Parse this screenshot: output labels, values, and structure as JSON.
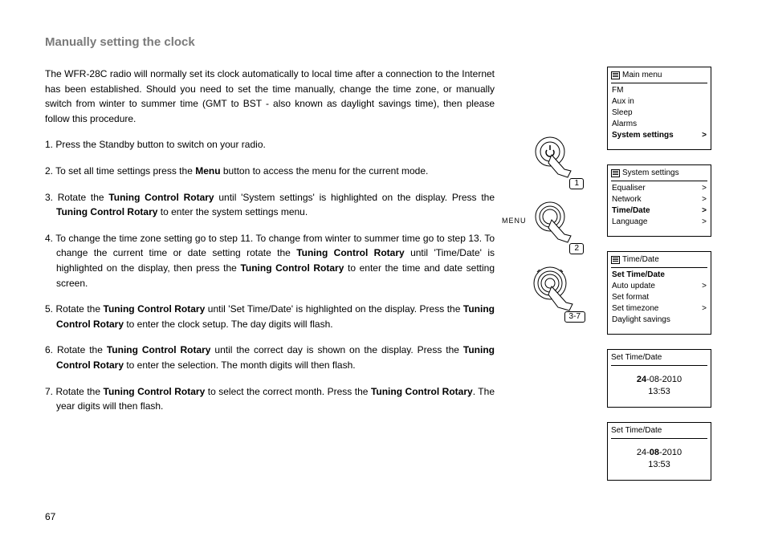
{
  "title": "Manually setting the clock",
  "page_num": "67",
  "intro": "The WFR-28C radio will normally set its clock automatically to local time after a connection to the Internet has been established. Should you need to set the time manually, change the time zone, or manually switch from winter to summer time (GMT to BST - also known as daylight savings time), then please follow this procedure.",
  "steps": {
    "s1": "1. Press the Standby button to switch on your radio.",
    "s2a": "2. To set all time settings press the ",
    "s2b": "Menu",
    "s2c": " button to access the menu for the current mode.",
    "s3a": "3. Rotate the ",
    "s3b": "Tuning Control Rotary",
    "s3c": " until 'System settings' is highlighted on the display. Press the ",
    "s3d": "Tuning Control Rotary",
    "s3e": " to enter the system settings menu.",
    "s4a": "4. To change the time zone setting go to step 11. To change from winter to summer time go to step 13. To change the current time or date setting rotate the ",
    "s4b": "Tuning Control Rotary",
    "s4c": " until 'Time/Date'  is highlighted on the display, then press the ",
    "s4d": "Tuning Control Rotary",
    "s4e": " to enter the time and date setting screen.",
    "s5a": "5. Rotate the ",
    "s5b": "Tuning Control Rotary",
    "s5c": " until 'Set Time/Date' is highlighted on the display. Press the ",
    "s5d": "Tuning Control Rotary",
    "s5e": " to enter the clock setup. The day digits will flash.",
    "s6a": "6. Rotate the ",
    "s6b": "Tuning Control Rotary",
    "s6c": " until the correct day is shown on the display. Press the ",
    "s6d": "Tuning Control Rotary",
    "s6e": " to enter the selection. The month digits will then flash.",
    "s7a": "7. Rotate the ",
    "s7b": "Tuning Control Rotary",
    "s7c": " to select the correct month. Press the ",
    "s7d": "Tuning Control Rotary",
    "s7e": ". The year digits will then flash."
  },
  "illus": {
    "menu_label": "MENU",
    "tag1": "1",
    "tag2": "2",
    "tag3": "3-7"
  },
  "menus": {
    "m1": {
      "title": "Main menu",
      "r1": "FM",
      "r2": "Aux in",
      "r3": "Sleep",
      "r4": "Alarms",
      "r5": "System settings",
      "gt": ">"
    },
    "m2": {
      "title": "System settings",
      "r1": "Equaliser",
      "r2": "Network",
      "r3": "Time/Date",
      "r4": "Language",
      "gt": ">"
    },
    "m3": {
      "title": "Time/Date",
      "r1": "Set Time/Date",
      "r2": "Auto update",
      "r3": "Set format",
      "r4": "Set timezone",
      "r5": "Daylight savings",
      "gt": ">"
    },
    "m4": {
      "title": "Set Time/Date",
      "day": "24",
      "sep": "-",
      "mon": "08",
      "yr": "-2010",
      "time": "13:53"
    },
    "m5": {
      "title": "Set Time/Date",
      "day": "24-",
      "mon": "08",
      "yr": "-2010",
      "time": "13:53"
    }
  }
}
